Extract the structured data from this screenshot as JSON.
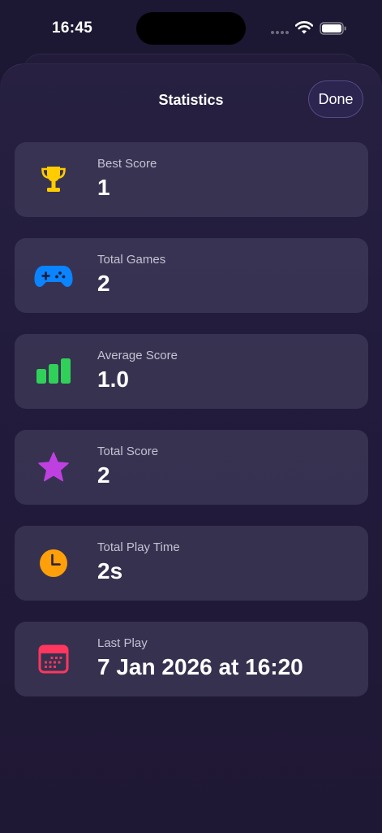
{
  "status_bar": {
    "time": "16:45",
    "icons": [
      "cellular-signal-icon",
      "wifi-icon",
      "battery-icon"
    ]
  },
  "header": {
    "title": "Statistics",
    "done_label": "Done"
  },
  "stats": [
    {
      "label": "Best Score",
      "value": "1",
      "icon": "trophy-icon",
      "color": "#FFCC00"
    },
    {
      "label": "Total Games",
      "value": "2",
      "icon": "gamecontroller-icon",
      "color": "#0A84FF"
    },
    {
      "label": "Average Score",
      "value": "1.0",
      "icon": "bar-chart-icon",
      "color": "#30D158"
    },
    {
      "label": "Total Score",
      "value": "2",
      "icon": "star-icon",
      "color": "#BF40E0"
    },
    {
      "label": "Total Play Time",
      "value": "2s",
      "icon": "clock-icon",
      "color": "#FF9F0A"
    },
    {
      "label": "Last Play",
      "value": "7 Jan 2026 at 16:20",
      "icon": "calendar-icon",
      "color": "#FF375F"
    }
  ]
}
